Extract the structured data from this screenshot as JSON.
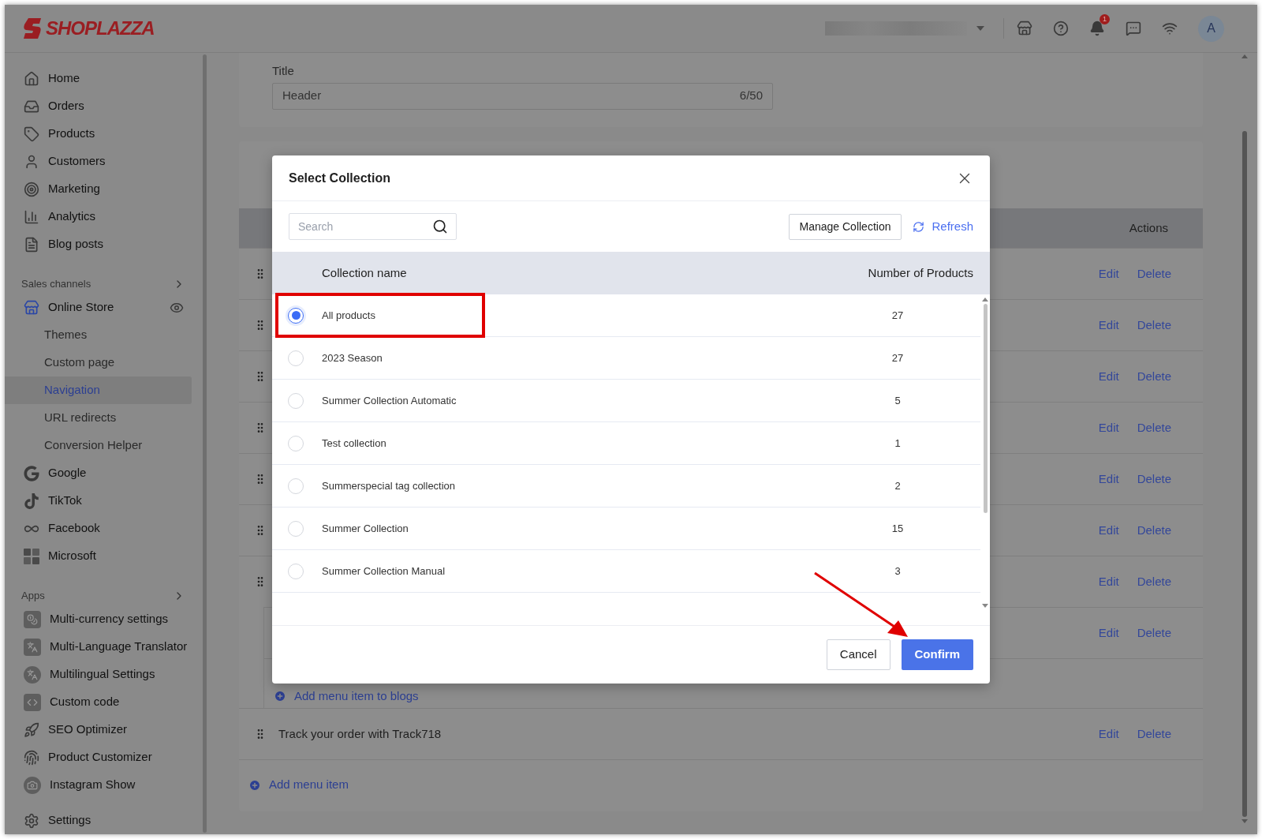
{
  "brand": {
    "name": "SHOPLAZZA"
  },
  "topbar": {
    "notification_count": "1",
    "avatar_initial": "A"
  },
  "sidebar": {
    "items": [
      {
        "label": "Home",
        "selected": false
      },
      {
        "label": "Orders",
        "selected": false
      },
      {
        "label": "Products",
        "selected": false
      },
      {
        "label": "Customers",
        "selected": false
      },
      {
        "label": "Marketing",
        "selected": false
      },
      {
        "label": "Analytics",
        "selected": false
      },
      {
        "label": "Blog posts",
        "selected": false
      }
    ],
    "sales_channels": {
      "heading": "Sales channels",
      "items": [
        {
          "label": "Online Store",
          "selected": false,
          "children": [
            {
              "label": "Themes",
              "selected": false
            },
            {
              "label": "Custom page",
              "selected": false
            },
            {
              "label": "Navigation",
              "selected": true
            },
            {
              "label": "URL redirects",
              "selected": false
            },
            {
              "label": "Conversion Helper",
              "selected": false
            }
          ]
        },
        {
          "label": "Google",
          "selected": false
        },
        {
          "label": "TikTok",
          "selected": false
        },
        {
          "label": "Facebook",
          "selected": false
        },
        {
          "label": "Microsoft",
          "selected": false
        }
      ]
    },
    "apps": {
      "heading": "Apps",
      "items": [
        {
          "label": "Multi-currency settings",
          "selected": false
        },
        {
          "label": "Multi-Language Translator",
          "selected": false
        },
        {
          "label": "Multilingual Settings",
          "selected": false
        },
        {
          "label": "Custom code",
          "selected": false
        },
        {
          "label": "SEO Optimizer",
          "selected": false
        },
        {
          "label": "Product Customizer",
          "selected": false
        },
        {
          "label": "Instagram Show",
          "selected": false
        }
      ]
    },
    "footer_items": [
      {
        "label": "Settings",
        "selected": false
      }
    ]
  },
  "title_field": {
    "label": "Title",
    "value": "Header",
    "counter": "6/50"
  },
  "menu": {
    "actions_heading": "Actions",
    "rows": [
      {
        "edit": "Edit",
        "delete": "Delete"
      },
      {
        "edit": "Edit",
        "delete": "Delete"
      },
      {
        "edit": "Edit",
        "delete": "Delete"
      },
      {
        "edit": "Edit",
        "delete": "Delete"
      },
      {
        "edit": "Edit",
        "delete": "Delete"
      },
      {
        "edit": "Edit",
        "delete": "Delete"
      },
      {
        "edit": "Edit",
        "delete": "Delete",
        "children": [
          {
            "edit": "Edit",
            "delete": "Delete"
          }
        ],
        "add_child": "Add menu item to blogs"
      },
      {
        "title": "Track your order with Track718",
        "edit": "Edit",
        "delete": "Delete"
      }
    ],
    "add_item": "Add menu item"
  },
  "dialog": {
    "title": "Select Collection",
    "search": {
      "placeholder": "Search"
    },
    "manage_button": "Manage Collection",
    "refresh": "Refresh",
    "columns": [
      "Collection name",
      "Number of Products"
    ],
    "rows": [
      {
        "name": "All products",
        "count": "27",
        "selected": true
      },
      {
        "name": "2023 Season",
        "count": "27",
        "selected": false
      },
      {
        "name": "Summer Collection Automatic",
        "count": "5",
        "selected": false
      },
      {
        "name": "Test collection",
        "count": "1",
        "selected": false
      },
      {
        "name": "Summerspecial tag collection",
        "count": "2",
        "selected": false
      },
      {
        "name": "Summer Collection",
        "count": "15",
        "selected": false
      },
      {
        "name": "Summer Collection Manual",
        "count": "3",
        "selected": false
      }
    ],
    "cancel": "Cancel",
    "confirm": "Confirm"
  }
}
